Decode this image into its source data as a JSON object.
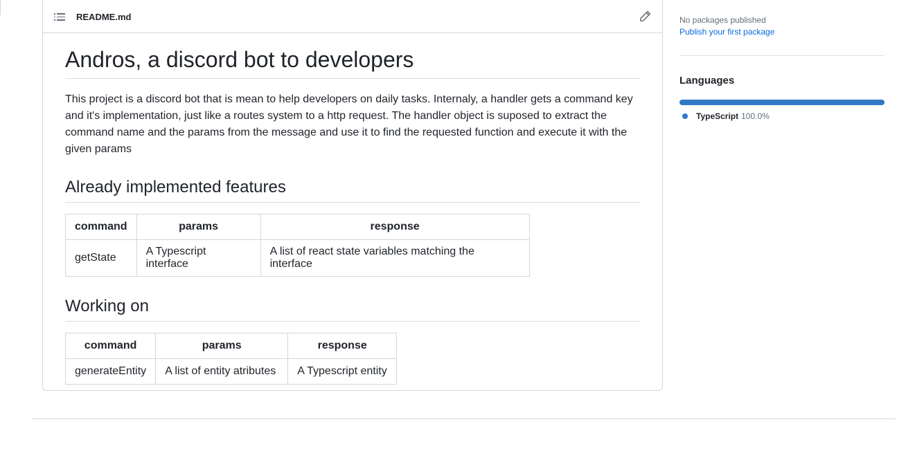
{
  "readme": {
    "filename": "README.md",
    "title": "Andros, a discord bot to developers",
    "intro": "This project is a discord bot that is mean to help developers on daily tasks. Internaly, a handler gets a command key and it's implementation, just like a routes system to a http request. The handler object is suposed to extract the command name and the params from the message and use it to find the requested function and execute it with the given params",
    "section1": {
      "title": "Already implemented features",
      "headers": [
        "command",
        "params",
        "response"
      ],
      "rows": [
        [
          "getState",
          "A Typescript interface",
          "A list of react state variables matching the interface"
        ]
      ]
    },
    "section2": {
      "title": "Working on",
      "headers": [
        "command",
        "params",
        "response"
      ],
      "rows": [
        [
          "generateEntity",
          "A list of entity atributes",
          "A Typescript entity"
        ]
      ]
    }
  },
  "packages": {
    "empty": "No packages published",
    "link": "Publish your first package"
  },
  "languages": {
    "title": "Languages",
    "items": [
      {
        "name": "TypeScript",
        "percent": "100.0%",
        "value": 100,
        "color": "#3178c6"
      }
    ]
  }
}
